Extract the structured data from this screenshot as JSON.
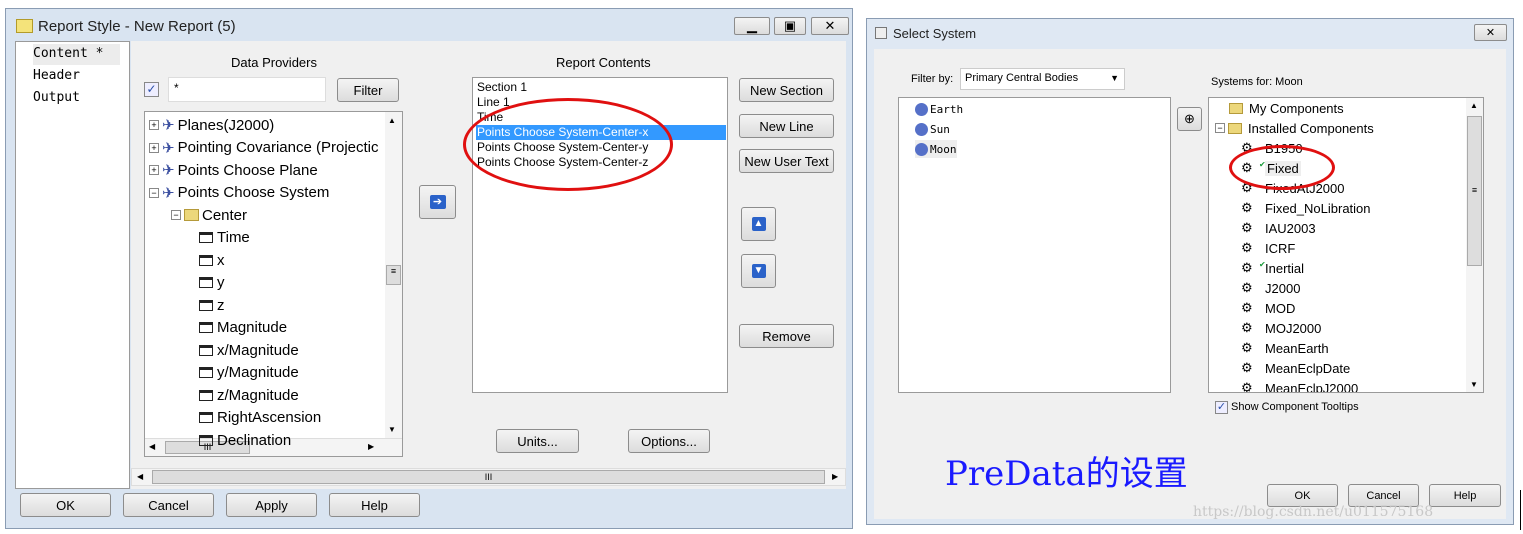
{
  "report_window": {
    "title": "Report Style - New Report (5)",
    "nav": [
      "Content *",
      "Header",
      "Output"
    ],
    "data_providers_label": "Data Providers",
    "filter_value": "*",
    "filter_button": "Filter",
    "tree": [
      {
        "label": "Planes(J2000)",
        "level": 0,
        "expander": "+"
      },
      {
        "label": "Pointing Covariance (Projectic",
        "level": 0,
        "expander": "+"
      },
      {
        "label": "Points Choose Plane",
        "level": 0,
        "expander": "+"
      },
      {
        "label": "Points Choose System",
        "level": 0,
        "expander": "-"
      },
      {
        "label": "Center",
        "level": 1,
        "expander": "-"
      },
      {
        "label": "Time",
        "level": 2
      },
      {
        "label": "x",
        "level": 2
      },
      {
        "label": "y",
        "level": 2
      },
      {
        "label": "z",
        "level": 2
      },
      {
        "label": "Magnitude",
        "level": 2
      },
      {
        "label": "x/Magnitude",
        "level": 2
      },
      {
        "label": "y/Magnitude",
        "level": 2
      },
      {
        "label": "z/Magnitude",
        "level": 2
      },
      {
        "label": "RightAscension",
        "level": 2
      },
      {
        "label": "Declination",
        "level": 2
      }
    ],
    "report_contents_label": "Report Contents",
    "report_contents": [
      "Section 1",
      "Line 1",
      "Time",
      "Points Choose System-Center-x",
      "Points Choose System-Center-y",
      "Points Choose System-Center-z"
    ],
    "selected_index": 3,
    "new_section": "New Section",
    "new_line": "New Line",
    "new_user_text": "New User Text",
    "remove": "Remove",
    "units": "Units...",
    "options": "Options...",
    "ok": "OK",
    "cancel": "Cancel",
    "apply": "Apply",
    "help": "Help"
  },
  "select_window": {
    "title": "Select System",
    "filter_by_label": "Filter by:",
    "filter_by_value": "Primary Central Bodies",
    "bodies": [
      "Earth",
      "Sun",
      "Moon"
    ],
    "systems_label": "Systems for: Moon",
    "folders": [
      "My Components",
      "Installed Components"
    ],
    "systems": [
      {
        "label": "B1950",
        "check": false
      },
      {
        "label": "Fixed",
        "check": true
      },
      {
        "label": "FixedAtJ2000",
        "check": false
      },
      {
        "label": "Fixed_NoLibration",
        "check": false
      },
      {
        "label": "IAU2003",
        "check": false
      },
      {
        "label": "ICRF",
        "check": false
      },
      {
        "label": "Inertial",
        "check": true
      },
      {
        "label": "J2000",
        "check": false
      },
      {
        "label": "MOD",
        "check": false
      },
      {
        "label": "MOJ2000",
        "check": false
      },
      {
        "label": "MeanEarth",
        "check": false
      },
      {
        "label": "MeanEclpDate",
        "check": false
      },
      {
        "label": "MeanEclpJ2000",
        "check": false
      }
    ],
    "show_tooltips": "Show Component Tooltips",
    "ok": "OK",
    "cancel": "Cancel",
    "help": "Help"
  },
  "annotation": "PreData的设置",
  "watermark": "https://blog.csdn.net/u011575168",
  "colors": {
    "highlight": "#3399ff",
    "annotation_circle": "#e01010",
    "annotation_text": "#1a1aff"
  }
}
